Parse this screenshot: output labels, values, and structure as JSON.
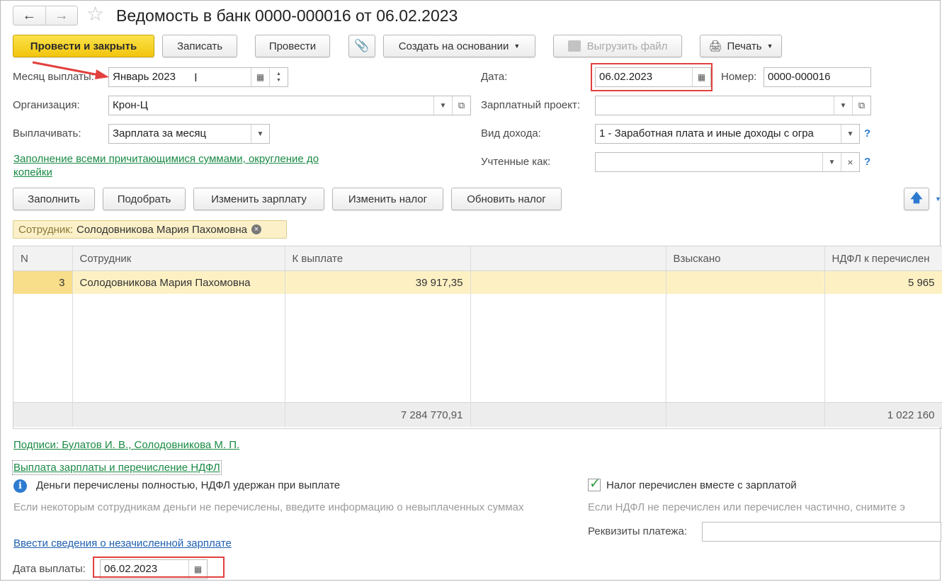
{
  "window": {
    "title": "Ведомость в банк 0000-000016 от 06.02.2023"
  },
  "toolbar": {
    "post_close": "Провести и закрыть",
    "save": "Записать",
    "post": "Провести",
    "create_based": "Создать на основании",
    "export_file": "Выгрузить файл",
    "print": "Печать"
  },
  "form": {
    "month_label": "Месяц выплаты:",
    "month_value": "Январь 2023",
    "date_label": "Дата:",
    "date_value": "06.02.2023",
    "number_label": "Номер:",
    "number_value": "0000-000016",
    "org_label": "Организация:",
    "org_value": "Крон-Ц",
    "salary_project_label": "Зарплатный проект:",
    "salary_project_value": "",
    "pay_label": "Выплачивать:",
    "pay_value": "Зарплата за месяц",
    "income_label": "Вид дохода:",
    "income_value": "1 - Заработная плата и иные доходы с огра",
    "accounted_label": "Учтенные как:",
    "accounted_value": "",
    "fill_link_1": "Заполнение всеми причитающимися суммами, округление до",
    "fill_link_2": "копейки",
    "help": "?"
  },
  "actions": {
    "fill": "Заполнить",
    "pick": "Подобрать",
    "change_salary": "Изменить зарплату",
    "change_tax": "Изменить налог",
    "update_tax": "Обновить налог"
  },
  "filter": {
    "label": "Сотрудник:",
    "value": "Солодовникова Мария Пахомовна"
  },
  "table": {
    "headers": {
      "n": "N",
      "employee": "Сотрудник",
      "to_pay": "К выплате",
      "collected": "Взыскано",
      "ndfl": "НДФЛ к перечислен"
    },
    "row": {
      "n": "3",
      "employee": "Солодовникова Мария Пахомовна",
      "to_pay": "39 917,35",
      "collected": "",
      "ndfl": "5 965"
    },
    "totals": {
      "to_pay": "7 284 770,91",
      "ndfl": "1 022 160"
    }
  },
  "bottom": {
    "signatures_link": "Подписи: Булатов И. В., Солодовникова М. П.",
    "payment_link": "Выплата зарплаты и перечисление НДФЛ",
    "info_text": "Деньги перечислены  полностью, НДФЛ удержан при выплате",
    "info_hint": "Если некоторым сотрудникам деньги не перечислены, введите информацию о невыплаченных суммах",
    "tax_checkbox_label": "Налог перечислен вместе с зарплатой",
    "tax_checked": true,
    "tax_hint": "Если НДФЛ не перечислен или перечислен частично, снимите э",
    "requisites_label": "Реквизиты платежа:",
    "requisites_value": "",
    "unaccrued_link": "Ввести сведения о незачисленной зарплате",
    "pay_date_label": "Дата выплаты:",
    "pay_date_value": "06.02.2023"
  },
  "colors": {
    "primary": "#f2c40e",
    "link": "#1a8a45",
    "highlight": "#e2403e",
    "selected_row": "#fdf1c4"
  }
}
